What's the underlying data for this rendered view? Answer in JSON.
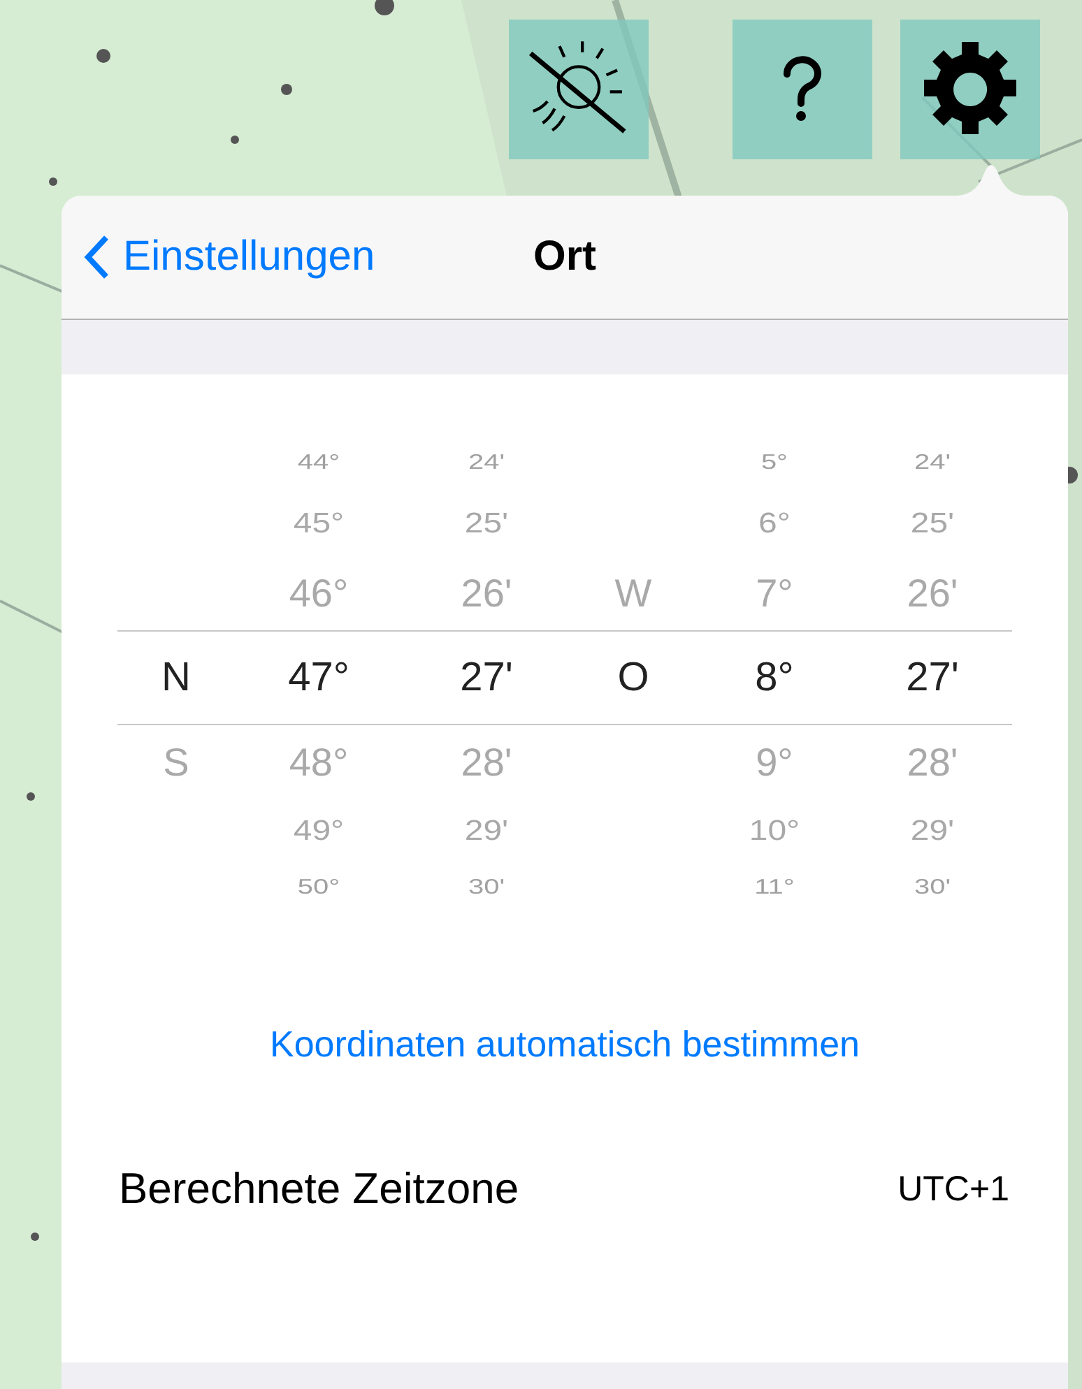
{
  "navigation": {
    "back": "Einstellungen",
    "title": "Ort"
  },
  "picker": {
    "columns": [
      {
        "items": [
          {
            "text": "N",
            "selected": true
          },
          {
            "text": "S",
            "selected": false
          }
        ]
      },
      {
        "items": [
          {
            "text": "44°",
            "selected": false
          },
          {
            "text": "45°",
            "selected": false
          },
          {
            "text": "46°",
            "selected": false
          },
          {
            "text": "47°",
            "selected": true
          },
          {
            "text": "48°",
            "selected": false
          },
          {
            "text": "49°",
            "selected": false
          },
          {
            "text": "50°",
            "selected": false
          }
        ]
      },
      {
        "items": [
          {
            "text": "24'",
            "selected": false
          },
          {
            "text": "25'",
            "selected": false
          },
          {
            "text": "26'",
            "selected": false
          },
          {
            "text": "27'",
            "selected": true
          },
          {
            "text": "28'",
            "selected": false
          },
          {
            "text": "29'",
            "selected": false
          },
          {
            "text": "30'",
            "selected": false
          }
        ]
      },
      {
        "items": [
          {
            "text": "W",
            "selected": false
          },
          {
            "text": "O",
            "selected": true
          }
        ]
      },
      {
        "items": [
          {
            "text": "5°",
            "selected": false
          },
          {
            "text": "6°",
            "selected": false
          },
          {
            "text": "7°",
            "selected": false
          },
          {
            "text": "8°",
            "selected": true
          },
          {
            "text": "9°",
            "selected": false
          },
          {
            "text": "10°",
            "selected": false
          },
          {
            "text": "11°",
            "selected": false
          }
        ]
      },
      {
        "items": [
          {
            "text": "24'",
            "selected": false
          },
          {
            "text": "25'",
            "selected": false
          },
          {
            "text": "26'",
            "selected": false
          },
          {
            "text": "27'",
            "selected": true
          },
          {
            "text": "28'",
            "selected": false
          },
          {
            "text": "29'",
            "selected": false
          },
          {
            "text": "30'",
            "selected": false
          }
        ]
      }
    ]
  },
  "auto_locate_link": "Koordinaten automatisch bestimmen",
  "timezone": {
    "label": "Berechnete Zeitzone",
    "value": "UTC+1"
  }
}
